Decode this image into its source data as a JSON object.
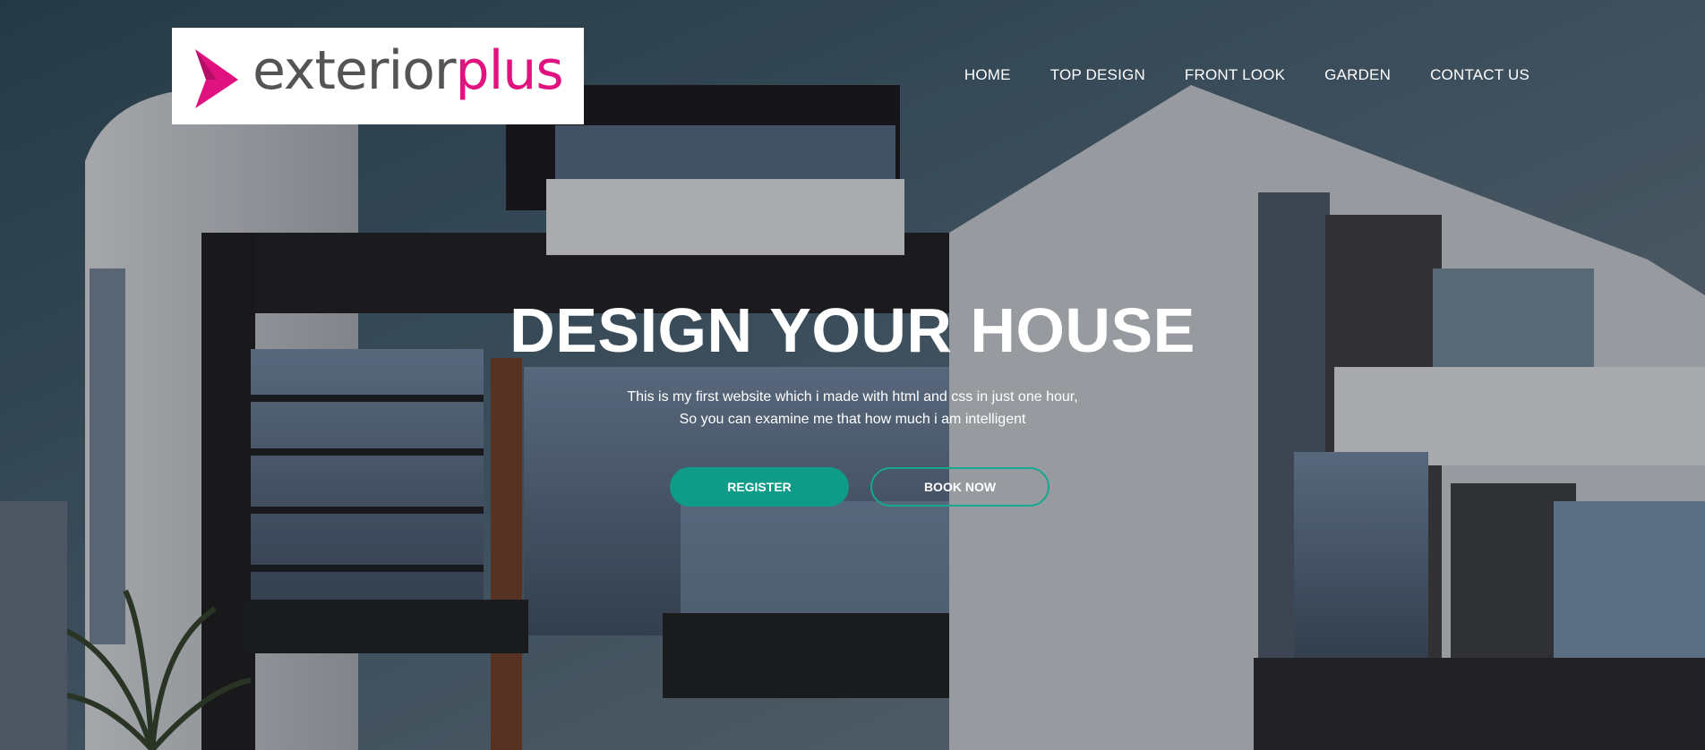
{
  "brand": {
    "part1": "exterior",
    "part2": "plus",
    "accent_color": "#e0127f",
    "text_color": "#545454",
    "icon": "play-triangle-logo-icon"
  },
  "nav": {
    "items": [
      {
        "label": "HOME"
      },
      {
        "label": "TOP DESIGN"
      },
      {
        "label": "FRONT LOOK"
      },
      {
        "label": "GARDEN"
      },
      {
        "label": "CONTACT US"
      }
    ]
  },
  "hero": {
    "title": "DESIGN YOUR HOUSE",
    "line1": "This is my first website which i made with html and css in just one hour,",
    "line2": "So you can examine me that how much i am intelligent",
    "register_label": "REGISTER",
    "book_label": "BOOK NOW",
    "button_color": "#0e9b87"
  }
}
